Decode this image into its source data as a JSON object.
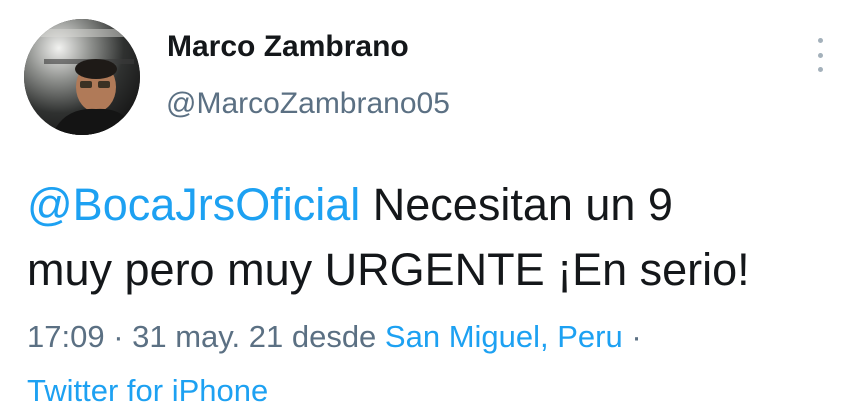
{
  "author": {
    "display_name": "Marco Zambrano",
    "handle": "@MarcoZambrano05"
  },
  "tweet": {
    "mention": "@BocaJrsOficial",
    "text_line1": " Necesitan un 9",
    "text_line2": "muy pero muy URGENTE ¡En serio!"
  },
  "meta": {
    "time": "17:09",
    "sep1": " · ",
    "date": "31 may. 21",
    "desde": " desde ",
    "location": "San Miguel, Peru",
    "sep2": " ·",
    "source": "Twitter for iPhone"
  },
  "colors": {
    "link": "#1da1f2",
    "secondary_text": "#5b7083",
    "primary_text": "#14171a"
  },
  "icons": {
    "more": "vertical-dots-icon"
  }
}
